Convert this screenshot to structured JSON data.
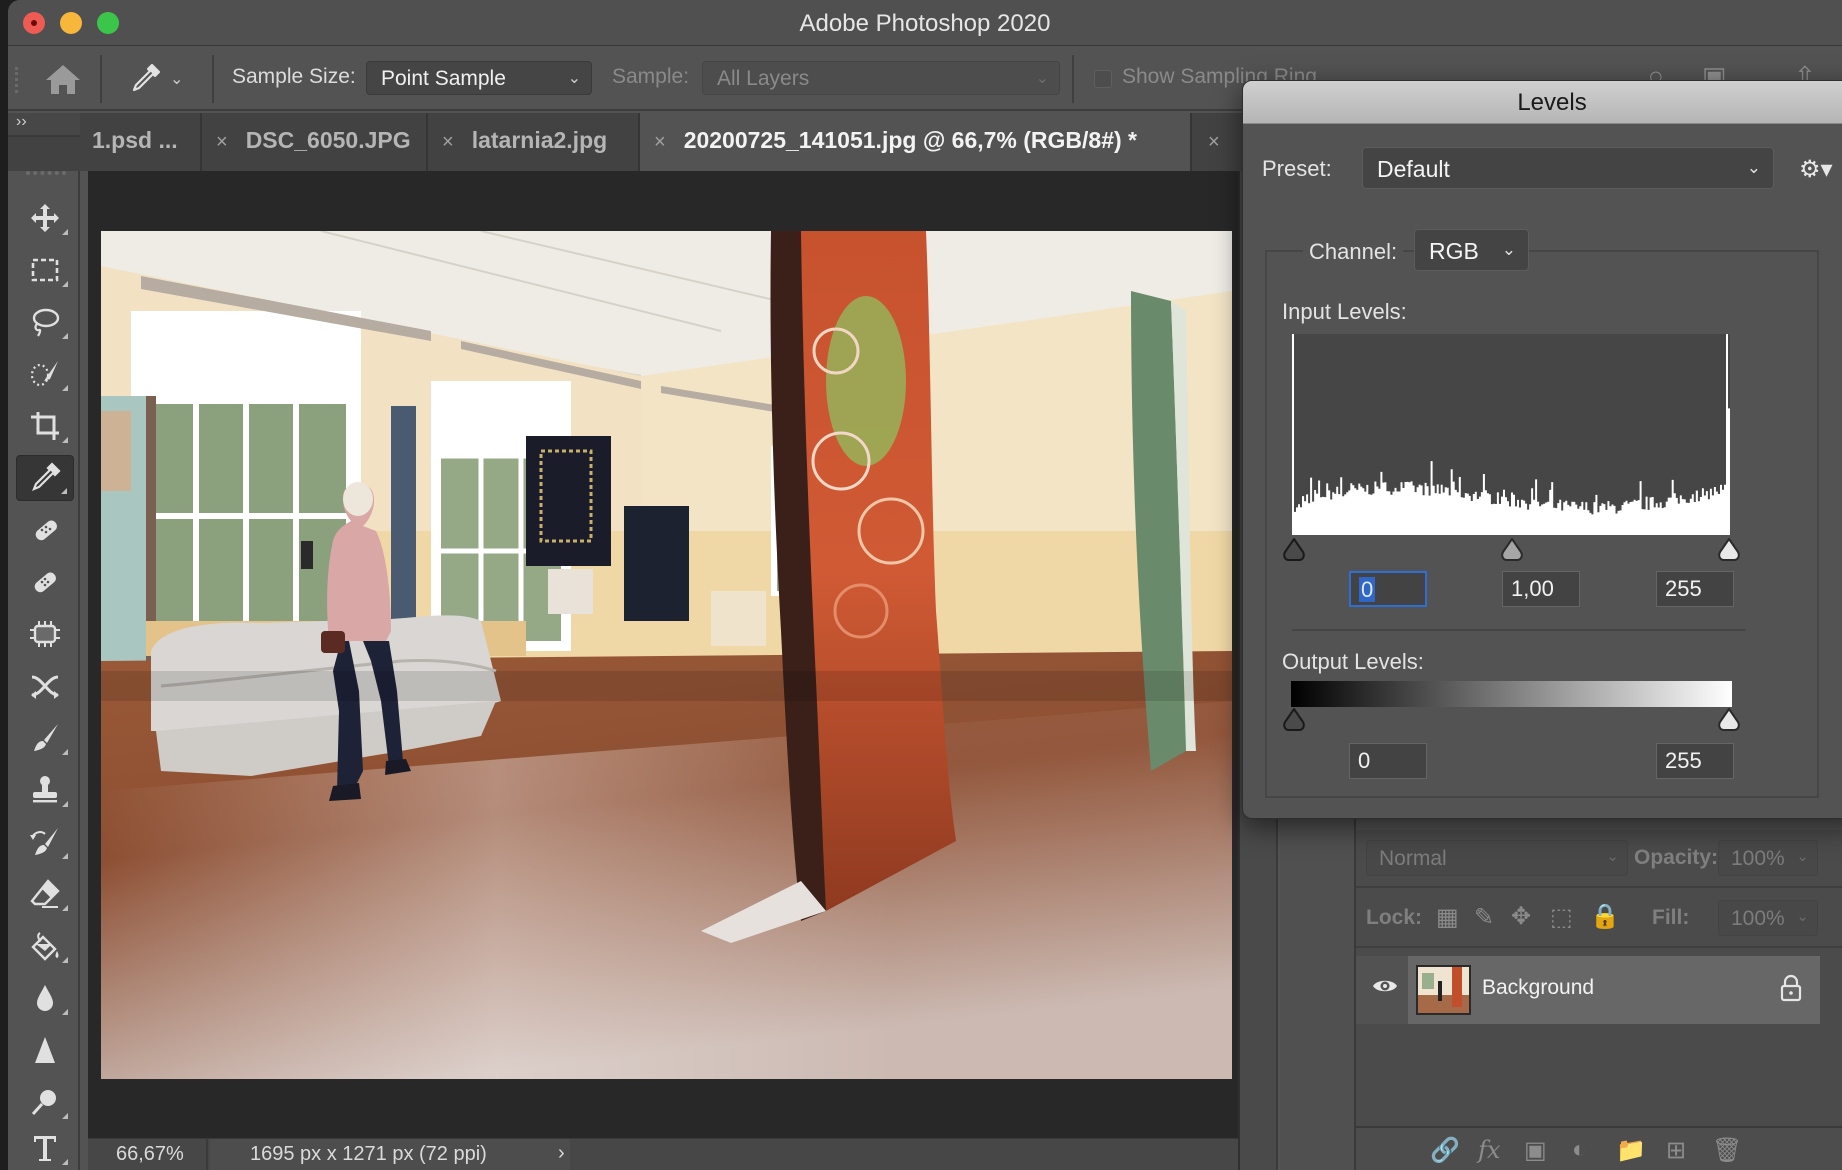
{
  "window": {
    "title": "Adobe Photoshop 2020"
  },
  "options_bar": {
    "sample_size_label": "Sample Size:",
    "sample_size_value": "Point Sample",
    "sample_label": "Sample:",
    "sample_value": "All Layers",
    "show_sampling_ring_label": "Show Sampling Ring",
    "show_sampling_ring_checked": false
  },
  "panel_collapse_label": "››",
  "tabs": [
    {
      "label": "1.psd ...",
      "closable": false,
      "active": false
    },
    {
      "label": "DSC_6050.JPG",
      "closable": true,
      "active": false
    },
    {
      "label": "latarnia2.jpg",
      "closable": true,
      "active": false
    },
    {
      "label": "20200725_141051.jpg @ 66,7% (RGB/8#) *",
      "closable": true,
      "active": true
    }
  ],
  "tab_close_glyph": "×",
  "toolbar": {
    "tools": [
      {
        "name": "move-tool",
        "active": false
      },
      {
        "name": "rectangular-marquee-tool",
        "active": false
      },
      {
        "name": "lasso-tool",
        "active": false
      },
      {
        "name": "quick-selection-tool",
        "active": false
      },
      {
        "name": "crop-tool",
        "active": false
      },
      {
        "name": "eyedropper-tool",
        "active": true
      },
      {
        "name": "spot-healing-brush-tool",
        "active": false
      },
      {
        "name": "healing-brush-tool",
        "active": false
      },
      {
        "name": "content-aware-tool",
        "active": false
      },
      {
        "name": "content-aware-move-tool",
        "active": false
      },
      {
        "name": "brush-tool",
        "active": false
      },
      {
        "name": "clone-stamp-tool",
        "active": false
      },
      {
        "name": "history-brush-tool",
        "active": false
      },
      {
        "name": "eraser-tool",
        "active": false
      },
      {
        "name": "paint-bucket-tool",
        "active": false
      },
      {
        "name": "blur-tool",
        "active": false
      },
      {
        "name": "sharpen-tool",
        "active": false
      },
      {
        "name": "dodge-tool",
        "active": false
      },
      {
        "name": "type-tool",
        "active": false
      }
    ]
  },
  "status_bar": {
    "zoom": "66,67%",
    "doc_info": "1695 px x 1271 px (72 ppi)",
    "arrow": "›"
  },
  "levels_dialog": {
    "title": "Levels",
    "preset_label": "Preset:",
    "preset_value": "Default",
    "channel_label": "Channel:",
    "channel_value": "RGB",
    "input_levels_label": "Input Levels:",
    "input_black": "0",
    "input_gamma": "1,00",
    "input_white": "255",
    "output_levels_label": "Output Levels:",
    "output_black": "0",
    "output_white": "255"
  },
  "layers_panel": {
    "blend_mode": "Normal",
    "opacity_label": "Opacity:",
    "opacity_value": "100%",
    "lock_label": "Lock:",
    "fill_label": "Fill:",
    "fill_value": "100%",
    "layers": [
      {
        "name": "Background",
        "visible": true,
        "locked": true
      }
    ]
  },
  "colors": {
    "panel_bg": "#535353",
    "canvas_bg": "#282828",
    "focus_blue": "#2f6fd3",
    "traffic_red": "#ed5b54",
    "traffic_yellow": "#f6b73a",
    "traffic_green": "#3bc64b"
  }
}
